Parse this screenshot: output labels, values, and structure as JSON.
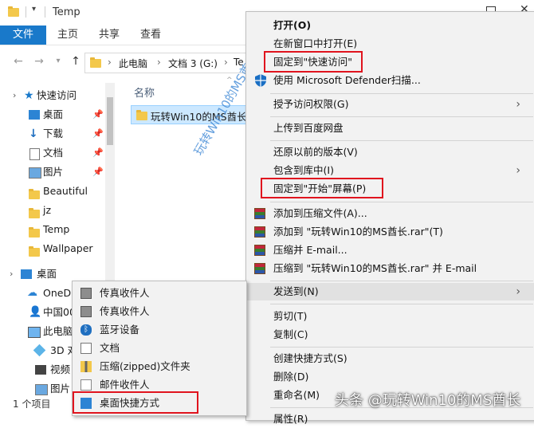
{
  "window": {
    "title": "Temp"
  },
  "ribbon": {
    "tabs": [
      "文件",
      "主页",
      "共享",
      "查看"
    ]
  },
  "address": {
    "segments": [
      "此电脑",
      "文档 3 (G:)",
      "Te"
    ]
  },
  "sidebar": {
    "items": [
      {
        "label": "快速访问",
        "icon": "star-icon"
      },
      {
        "label": "桌面",
        "icon": "desktop-icon",
        "pinned": true
      },
      {
        "label": "下载",
        "icon": "download-icon",
        "pinned": true
      },
      {
        "label": "文档",
        "icon": "document-icon",
        "pinned": true
      },
      {
        "label": "图片",
        "icon": "picture-icon",
        "pinned": true
      },
      {
        "label": "Beautiful",
        "icon": "folder-icon"
      },
      {
        "label": "jz",
        "icon": "folder-icon"
      },
      {
        "label": "Temp",
        "icon": "folder-icon"
      },
      {
        "label": "Wallpaper",
        "icon": "folder-icon"
      },
      {
        "label": "桌面",
        "icon": "desktop-icon"
      },
      {
        "label": "OneD",
        "icon": "cloud-icon"
      },
      {
        "label": "中国00",
        "icon": "user-icon"
      },
      {
        "label": "此电脑",
        "icon": "computer-icon"
      },
      {
        "label": "3D 对",
        "icon": "3d-objects-icon"
      },
      {
        "label": "视频",
        "icon": "video-icon"
      },
      {
        "label": "图片",
        "icon": "picture-icon"
      }
    ]
  },
  "filelist": {
    "column_name": "名称",
    "files": [
      {
        "name": "玩转Win10的MS酋长"
      }
    ]
  },
  "watermark": "玩转Win10的MS酋长",
  "status": {
    "count": "1 个项目"
  },
  "context_menu": {
    "items": [
      {
        "label": "打开(O)",
        "bold": true
      },
      {
        "label": "在新窗口中打开(E)"
      },
      {
        "label": "固定到\"快速访问\""
      },
      {
        "label": "使用 Microsoft Defender扫描..."
      },
      {
        "label": "授予访问权限(G)",
        "submenu": true
      },
      {
        "label": "上传到百度网盘"
      },
      {
        "label": "还原以前的版本(V)"
      },
      {
        "label": "包含到库中(I)",
        "submenu": true
      },
      {
        "label": "固定到\"开始\"屏幕(P)"
      },
      {
        "label": "添加到压缩文件(A)..."
      },
      {
        "label": "添加到 \"玩转Win10的MS酋长.rar\"(T)"
      },
      {
        "label": "压缩并 E-mail..."
      },
      {
        "label": "压缩到 \"玩转Win10的MS酋长.rar\" 并 E-mail"
      },
      {
        "label": "发送到(N)",
        "submenu": true,
        "highlighted": true
      },
      {
        "label": "剪切(T)"
      },
      {
        "label": "复制(C)"
      },
      {
        "label": "创建快捷方式(S)"
      },
      {
        "label": "删除(D)"
      },
      {
        "label": "重命名(M)"
      },
      {
        "label": "属性(R)"
      }
    ]
  },
  "sendto_menu": {
    "items": [
      {
        "label": "传真收件人",
        "icon": "fax-icon"
      },
      {
        "label": "传真收件人",
        "icon": "fax-icon"
      },
      {
        "label": "蓝牙设备",
        "icon": "bluetooth-icon"
      },
      {
        "label": "文档",
        "icon": "document-icon"
      },
      {
        "label": "压缩(zipped)文件夹",
        "icon": "zip-folder-icon"
      },
      {
        "label": "邮件收件人",
        "icon": "mail-icon"
      },
      {
        "label": "桌面快捷方式",
        "icon": "desktop-icon"
      }
    ]
  },
  "credit": "头条 @玩转Win10的MS酋长",
  "colors": {
    "accent": "#1979ca",
    "highlight_box": "#e0141e",
    "menu_bg": "#f2f2f2"
  }
}
